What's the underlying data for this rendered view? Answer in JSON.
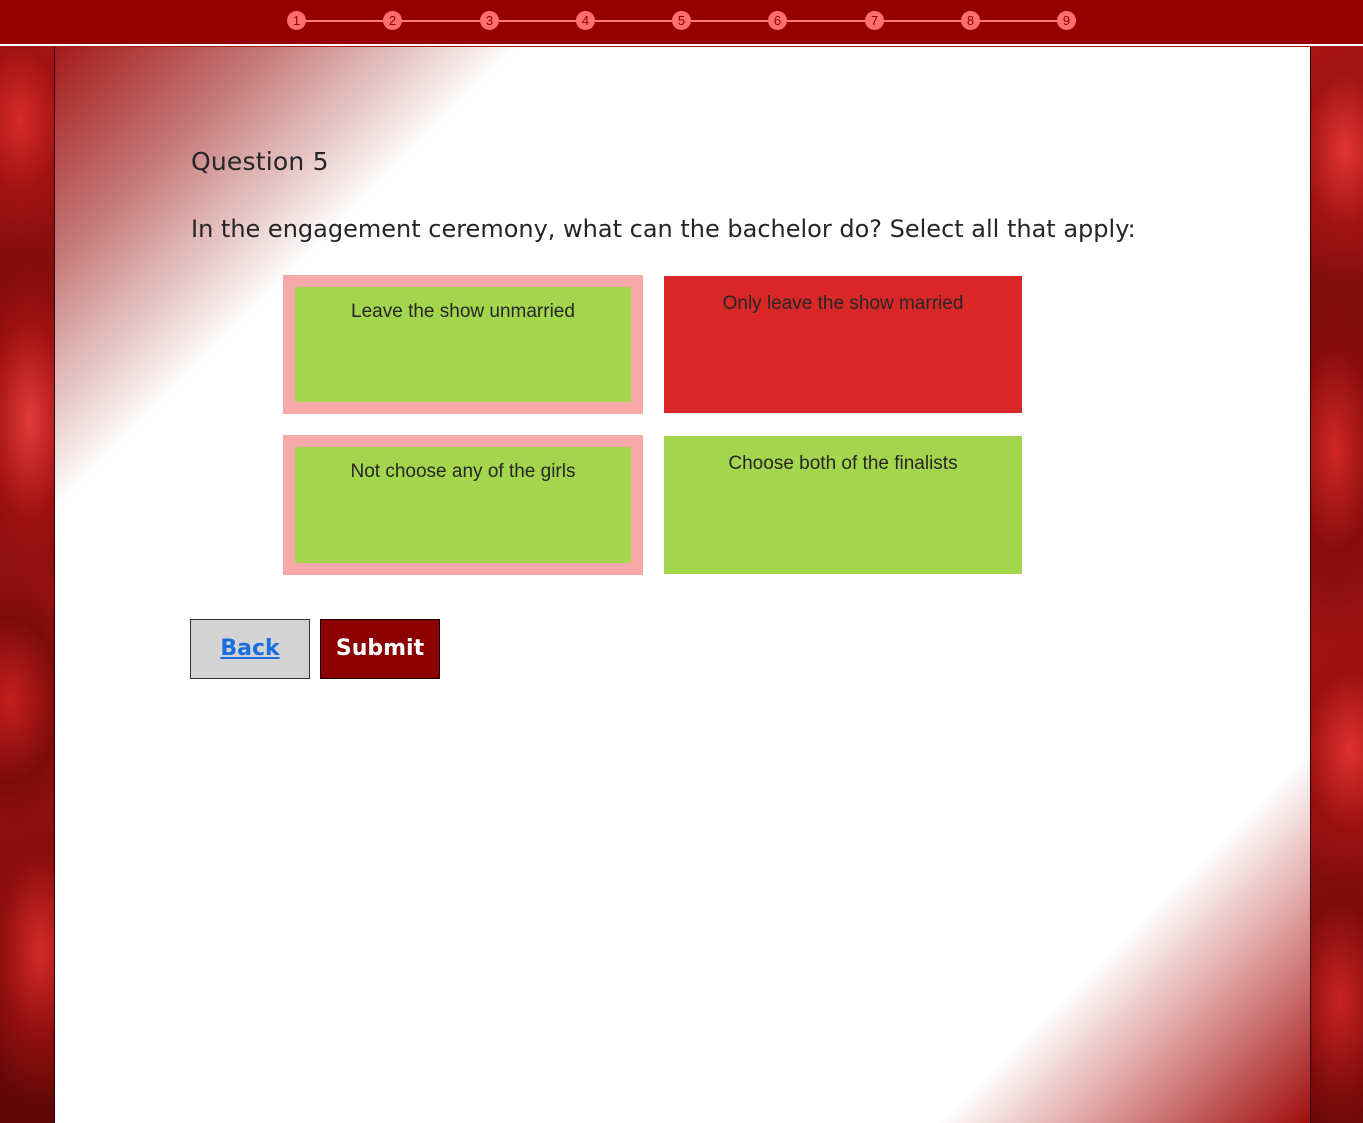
{
  "progress": {
    "steps": [
      "1",
      "2",
      "3",
      "4",
      "5",
      "6",
      "7",
      "8",
      "9"
    ],
    "current_step": "5"
  },
  "question": {
    "number_label": "Question 5",
    "text": "In the engagement ceremony, what can the bachelor do? Select all that apply:"
  },
  "options": [
    {
      "label": "Leave the show unmarried",
      "selected": true,
      "color": "#a3d64c"
    },
    {
      "label": "Only leave the show married",
      "selected": false,
      "color": "#d92727"
    },
    {
      "label": "Not choose any of the girls",
      "selected": true,
      "color": "#a3d64c"
    },
    {
      "label": "Choose both of the finalists",
      "selected": false,
      "color": "#a3d64c"
    }
  ],
  "buttons": {
    "back_label": "Back",
    "submit_label": "Submit"
  },
  "colors": {
    "header": "#950000",
    "selected_border": "#f7a9a9",
    "option_green": "#a3d64c",
    "option_red": "#d92727",
    "submit": "#8b0000",
    "back": "#d3d3d3",
    "back_text": "#1a6fe0"
  }
}
